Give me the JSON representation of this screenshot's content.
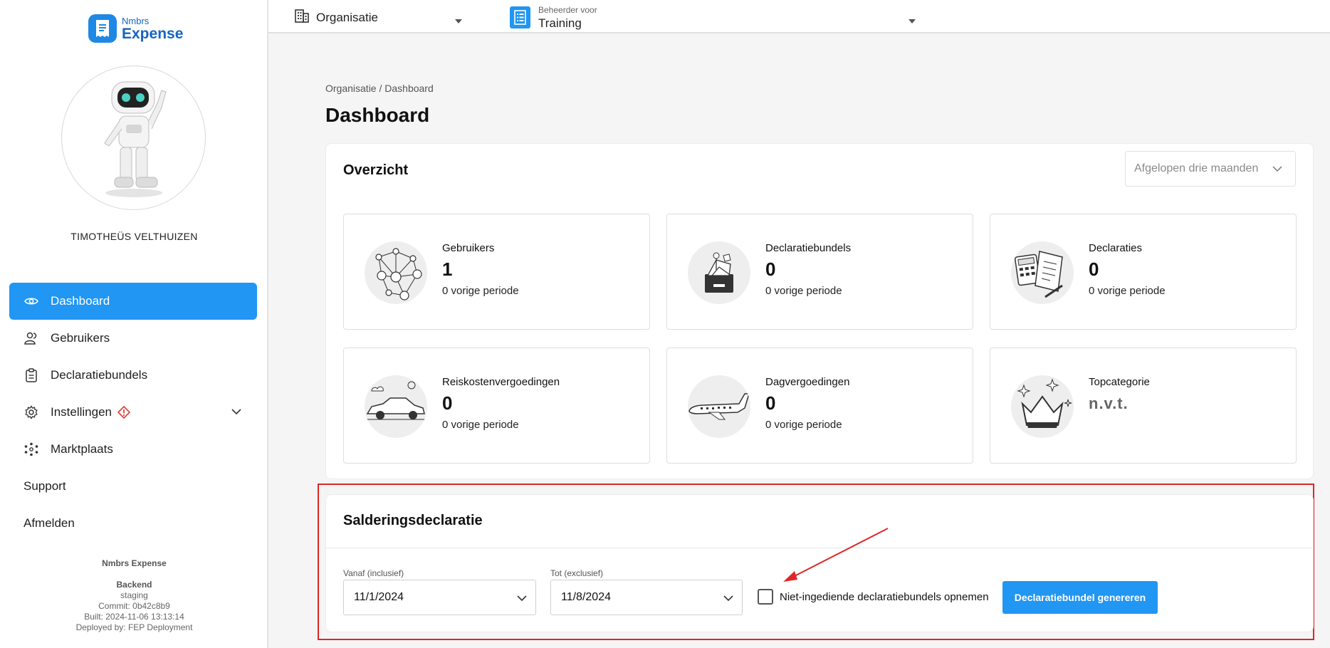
{
  "app": {
    "logo_small": "Nmbrs",
    "logo_big": "Expense"
  },
  "user": {
    "name": "TIMOTHEÜS VELTHUIZEN"
  },
  "sidebar": {
    "items": [
      {
        "label": "Dashboard",
        "icon": "eye-icon",
        "active": true
      },
      {
        "label": "Gebruikers",
        "icon": "users-icon"
      },
      {
        "label": "Declaratiebundels",
        "icon": "clipboard-icon"
      },
      {
        "label": "Instellingen",
        "icon": "gear-icon"
      },
      {
        "label": "Marktplaats",
        "icon": "marketplace-icon"
      }
    ],
    "support": "Support",
    "logout": "Afmelden"
  },
  "build": {
    "product": "Nmbrs Expense",
    "backend_title": "Backend",
    "environment": "staging",
    "commit": "Commit: 0b42c8b9",
    "built": "Built: 2024-11-06 13:13:14",
    "deployed": "Deployed by: FEP Deployment"
  },
  "topbar": {
    "organisation_label": "Organisatie",
    "admin_small": "Beheerder voor",
    "admin_value": "Training"
  },
  "breadcrumb": "Organisatie / Dashboard",
  "page_title": "Dashboard",
  "overview": {
    "title": "Overzicht",
    "period": "Afgelopen drie maanden",
    "stats": [
      {
        "label": "Gebruikers",
        "value": "1",
        "previous": "0 vorige periode"
      },
      {
        "label": "Declaratiebundels",
        "value": "0",
        "previous": "0 vorige periode"
      },
      {
        "label": "Declaraties",
        "value": "0",
        "previous": "0 vorige periode"
      },
      {
        "label": "Reiskostenvergoedingen",
        "value": "0",
        "previous": "0 vorige periode"
      },
      {
        "label": "Dagvergoedingen",
        "value": "0",
        "previous": "0 vorige periode"
      },
      {
        "label": "Topcategorie",
        "value": "n.v.t."
      }
    ]
  },
  "saldering": {
    "title": "Salderingsdeclaratie",
    "from_label": "Vanaf (inclusief)",
    "from_value": "11/1/2024",
    "to_label": "Tot (exclusief)",
    "to_value": "11/8/2024",
    "checkbox_label": "Niet-ingediende declaratiebundels opnemen",
    "checkbox_checked": false,
    "button_label": "Declaratiebundel genereren"
  },
  "colors": {
    "accent": "#2196f3",
    "annotation": "#e02626"
  }
}
